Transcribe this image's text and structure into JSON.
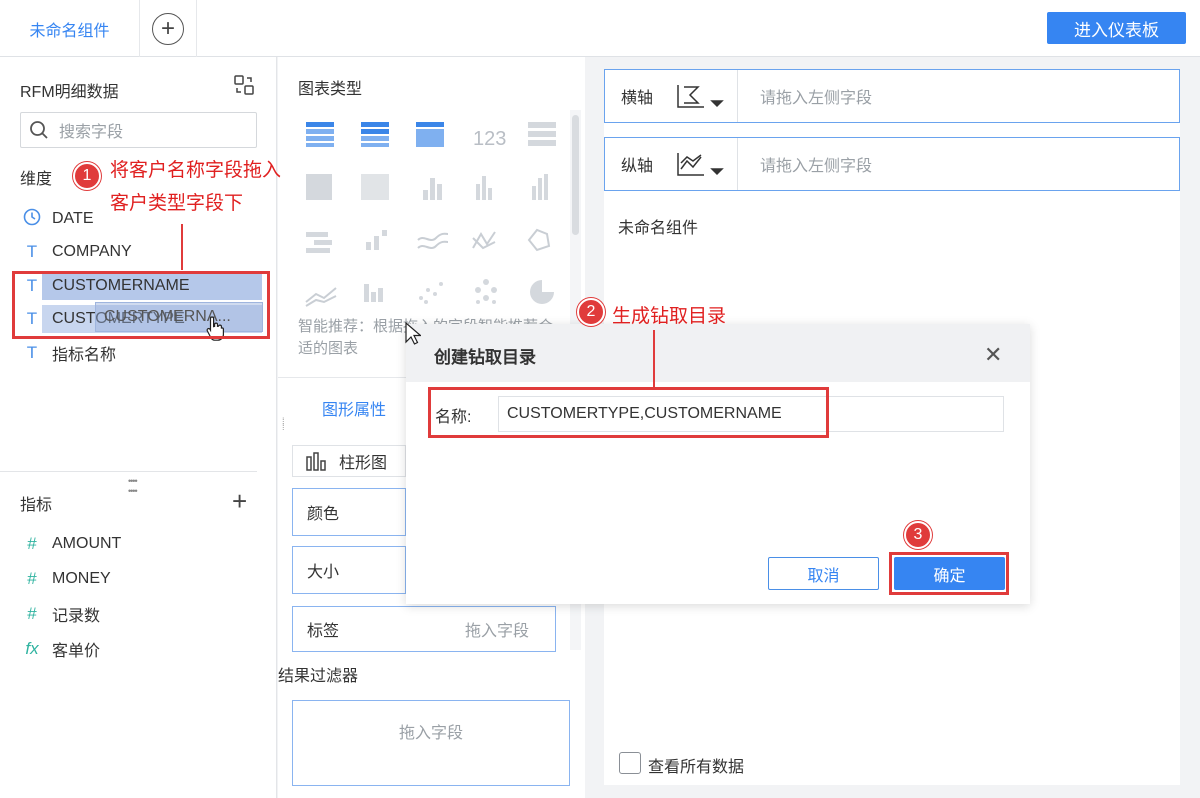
{
  "topbar": {
    "active_tab": "未命名组件",
    "dashboard_button": "进入仪表板"
  },
  "data_panel": {
    "dataset_title": "RFM明细数据",
    "search_placeholder": "搜索字段",
    "dimension_label": "维度",
    "dimensions": [
      {
        "icon": "clock-icon",
        "glyph": "◷",
        "name": "DATE"
      },
      {
        "icon": "text-field-icon",
        "glyph": "T",
        "name": "COMPANY"
      },
      {
        "icon": "text-field-icon",
        "glyph": "T",
        "name": "CUSTOMERNAME"
      },
      {
        "icon": "text-field-icon",
        "glyph": "T",
        "name": "CUSTOMERTYPE"
      },
      {
        "icon": "text-formula-icon",
        "glyph": "T",
        "name": "指标名称"
      }
    ],
    "drag_ghost": "CUSTOMERNA...",
    "metric_label": "指标",
    "metrics": [
      {
        "icon": "number-field-icon",
        "glyph": "#",
        "name": "AMOUNT"
      },
      {
        "icon": "number-field-icon",
        "glyph": "#",
        "name": "MONEY"
      },
      {
        "icon": "number-formula-icon",
        "glyph": "#",
        "name": "记录数"
      },
      {
        "icon": "function-icon",
        "glyph": "fx",
        "name": "客单价"
      }
    ]
  },
  "chart_panel": {
    "title": "图表类型",
    "smart_hint": "智能推荐：根据拖入的字段智能推荐合适的图表",
    "property_tab": "图形属性",
    "chart_type_selected": "柱形图",
    "properties": [
      "颜色",
      "大小"
    ],
    "tag_label": "标签",
    "tag_placeholder": "拖入字段",
    "filter_title": "结果过滤器",
    "filter_placeholder": "拖入字段"
  },
  "axes": {
    "x_label": "横轴",
    "y_label": "纵轴",
    "placeholder": "请拖入左侧字段"
  },
  "canvas": {
    "title": "未命名组件",
    "view_all_label": "查看所有数据",
    "view_all_checked": false
  },
  "dialog": {
    "title": "创建钻取目录",
    "name_label": "名称:",
    "name_value": "CUSTOMERTYPE,CUSTOMERNAME",
    "cancel": "取消",
    "confirm": "确定"
  },
  "annotations": {
    "step1_num": "1",
    "step1_line1": "将客户名称字段拖入",
    "step1_line2": "客户类型字段下",
    "step2_num": "2",
    "step2_text": "生成钻取目录",
    "step3_num": "3"
  },
  "colors": {
    "accent": "#3685f2",
    "annotation": "#e03b3b"
  }
}
